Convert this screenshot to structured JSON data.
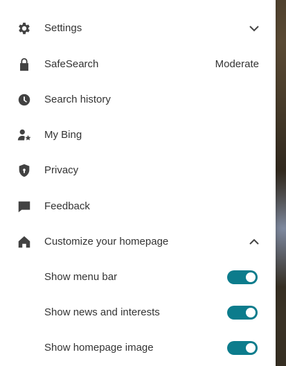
{
  "menu": {
    "settings": {
      "label": "Settings",
      "icon": "gear-icon",
      "state": "collapsed"
    },
    "safesearch": {
      "label": "SafeSearch",
      "value": "Moderate",
      "icon": "lock-icon"
    },
    "history": {
      "label": "Search history",
      "icon": "clock-icon"
    },
    "mybing": {
      "label": "My Bing",
      "icon": "user-star-icon"
    },
    "privacy": {
      "label": "Privacy",
      "icon": "shield-icon"
    },
    "feedback": {
      "label": "Feedback",
      "icon": "chat-bubble-icon"
    },
    "customize": {
      "label": "Customize your homepage",
      "icon": "home-icon",
      "state": "expanded"
    }
  },
  "homepage_options": [
    {
      "label": "Show menu bar",
      "enabled": true
    },
    {
      "label": "Show news and interests",
      "enabled": true
    },
    {
      "label": "Show homepage image",
      "enabled": true
    }
  ],
  "colors": {
    "toggle_on": "#0c7c8c",
    "text": "#333333",
    "icon": "#424242"
  }
}
